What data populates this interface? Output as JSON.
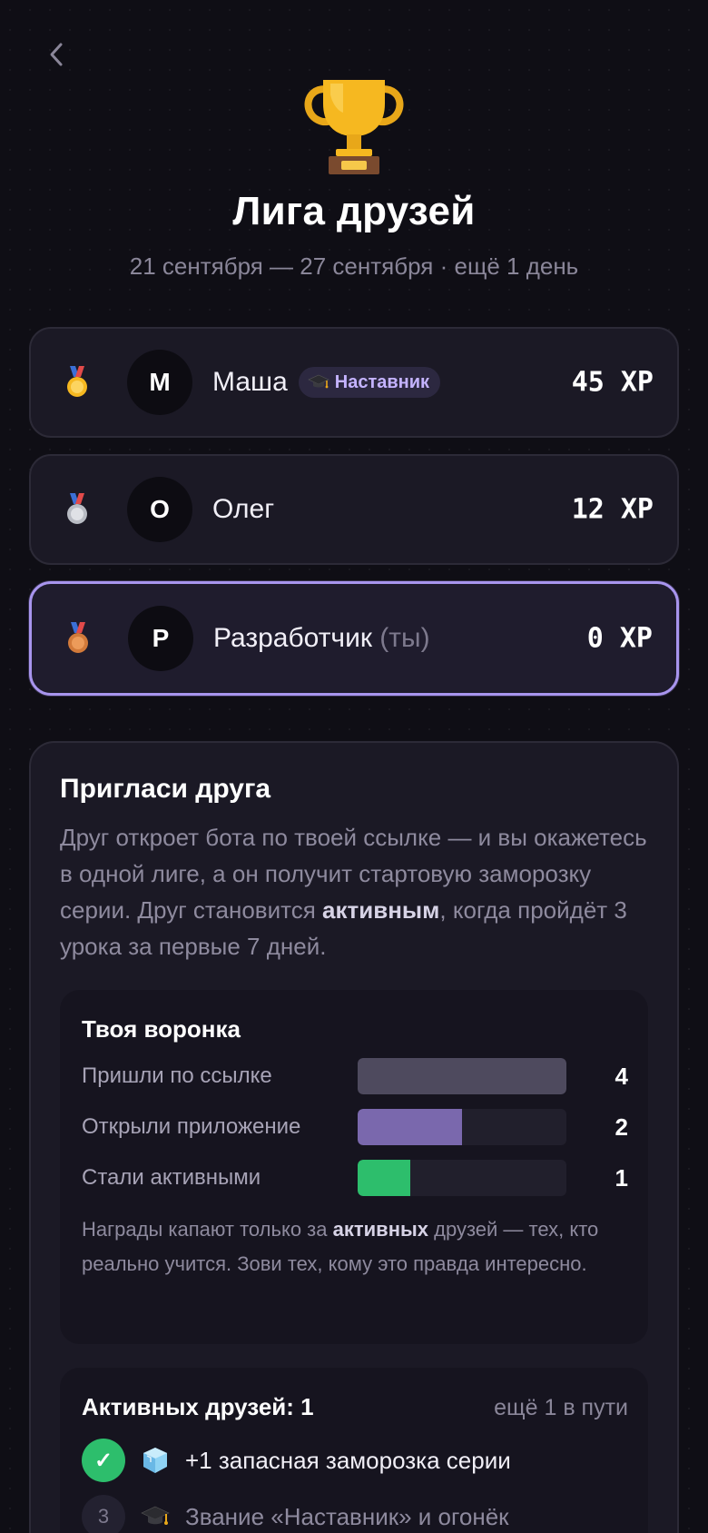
{
  "nav": {
    "back_icon": "chevron-left-icon"
  },
  "header": {
    "icon": "trophy-icon",
    "title": "Лига друзей",
    "subtitle": "21 сентября — 27 сентября · ещё 1 день"
  },
  "leaderboard": [
    {
      "medal": "gold-medal-icon",
      "initial": "М",
      "name": "Маша",
      "badge": {
        "icon": "graduation-cap-icon",
        "label": "Наставник"
      },
      "xp": "45 XP"
    },
    {
      "medal": "silver-medal-icon",
      "initial": "О",
      "name": "Олег",
      "xp": "12 XP"
    },
    {
      "medal": "bronze-medal-icon",
      "initial": "Р",
      "name": "Разработчик",
      "you_label": "(ты)",
      "xp": "0 XP"
    }
  ],
  "invite": {
    "title": "Пригласи друга",
    "text_1": "Друг откроет бота по твоей ссылке — и вы окажетесь в одной лиге, а он получит стартовую заморозку серии. Друг становится ",
    "text_bold": "активным",
    "text_2": ", когда пройдёт 3 урока за первые 7 дней."
  },
  "funnel": {
    "title": "Твоя воронка",
    "rows": [
      {
        "label": "Пришли по ссылке",
        "value": "4",
        "fraction": 1.0,
        "color": "#4e4a5e"
      },
      {
        "label": "Открыли приложение",
        "value": "2",
        "fraction": 0.5,
        "color": "#7a68ad"
      },
      {
        "label": "Стали активными",
        "value": "1",
        "fraction": 0.25,
        "color": "#2dbe6c"
      }
    ],
    "note_1": "Награды капают только за ",
    "note_bold": "активных",
    "note_2": " друзей — тех, кто реально учится. Зови тех, кому это правда интересно."
  },
  "active_friends": {
    "title": "Активных друзей: 1",
    "subtitle": "ещё 1 в пути",
    "rewards": [
      {
        "done": true,
        "icon": "ice-cube-icon",
        "label": "+1 запасная заморозка серии"
      },
      {
        "done": false,
        "step": "3",
        "icon": "graduation-cap-icon",
        "label": "Звание «Наставник» и огонёк"
      }
    ]
  }
}
